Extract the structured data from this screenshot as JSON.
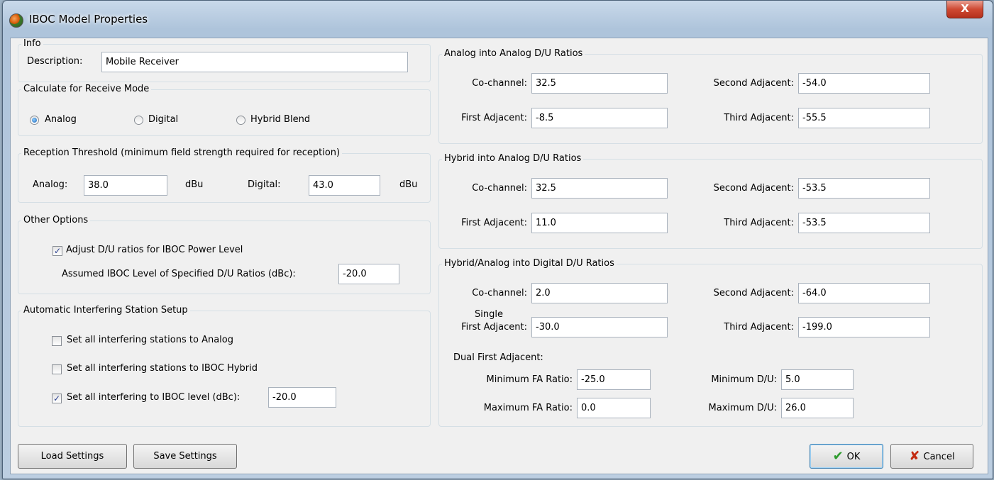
{
  "window": {
    "title": "IBOC Model Properties",
    "close_glyph": "X"
  },
  "info": {
    "title": "Info",
    "description_label": "Description:",
    "description_value": "Mobile Receiver"
  },
  "receive_mode": {
    "title": "Calculate for Receive Mode",
    "options": [
      {
        "label": "Analog",
        "selected": true
      },
      {
        "label": "Digital",
        "selected": false
      },
      {
        "label": "Hybrid Blend",
        "selected": false
      }
    ]
  },
  "threshold": {
    "title": "Reception Threshold (minimum field strength required for reception)",
    "analog_label": "Analog:",
    "analog_value": "38.0",
    "analog_unit": "dBu",
    "digital_label": "Digital:",
    "digital_value": "43.0",
    "digital_unit": "dBu"
  },
  "other_options": {
    "title": "Other Options",
    "adjust_label": "Adjust D/U ratios for IBOC Power Level",
    "adjust_checked": true,
    "assumed_label": "Assumed IBOC Level of Specified D/U Ratios (dBc):",
    "assumed_value": "-20.0"
  },
  "auto_setup": {
    "title": "Automatic Interfering Station Setup",
    "analog_label": "Set all interfering stations to Analog",
    "analog_checked": false,
    "hybrid_label": "Set all interfering stations to IBOC Hybrid",
    "hybrid_checked": false,
    "level_label": "Set all interfering to IBOC level (dBc):",
    "level_checked": true,
    "level_value": "-20.0"
  },
  "analog_analog": {
    "title": "Analog into Analog D/U Ratios",
    "cochannel_label": "Co-channel:",
    "cochannel_value": "32.5",
    "second_label": "Second Adjacent:",
    "second_value": "-54.0",
    "first_label": "First Adjacent:",
    "first_value": "-8.5",
    "third_label": "Third Adjacent:",
    "third_value": "-55.5"
  },
  "hybrid_analog": {
    "title": "Hybrid into Analog D/U Ratios",
    "cochannel_label": "Co-channel:",
    "cochannel_value": "32.5",
    "second_label": "Second Adjacent:",
    "second_value": "-53.5",
    "first_label": "First Adjacent:",
    "first_value": "11.0",
    "third_label": "Third Adjacent:",
    "third_value": "-53.5"
  },
  "digital": {
    "title": "Hybrid/Analog into Digital D/U Ratios",
    "cochannel_label": "Co-channel:",
    "cochannel_value": "2.0",
    "second_label": "Second Adjacent:",
    "second_value": "-64.0",
    "single_label": "Single",
    "first_label": "First Adjacent:",
    "first_value": "-30.0",
    "third_label": "Third Adjacent:",
    "third_value": "-199.0",
    "dual_label": "Dual First Adjacent:",
    "min_fa_label": "Minimum FA Ratio:",
    "min_fa_value": "-25.0",
    "max_fa_label": "Maximum FA Ratio:",
    "max_fa_value": "0.0",
    "min_du_label": "Minimum D/U:",
    "min_du_value": "5.0",
    "max_du_label": "Maximum D/U:",
    "max_du_value": "26.0"
  },
  "buttons": {
    "load": "Load Settings",
    "save": "Save Settings",
    "ok": "OK",
    "cancel": "Cancel"
  }
}
